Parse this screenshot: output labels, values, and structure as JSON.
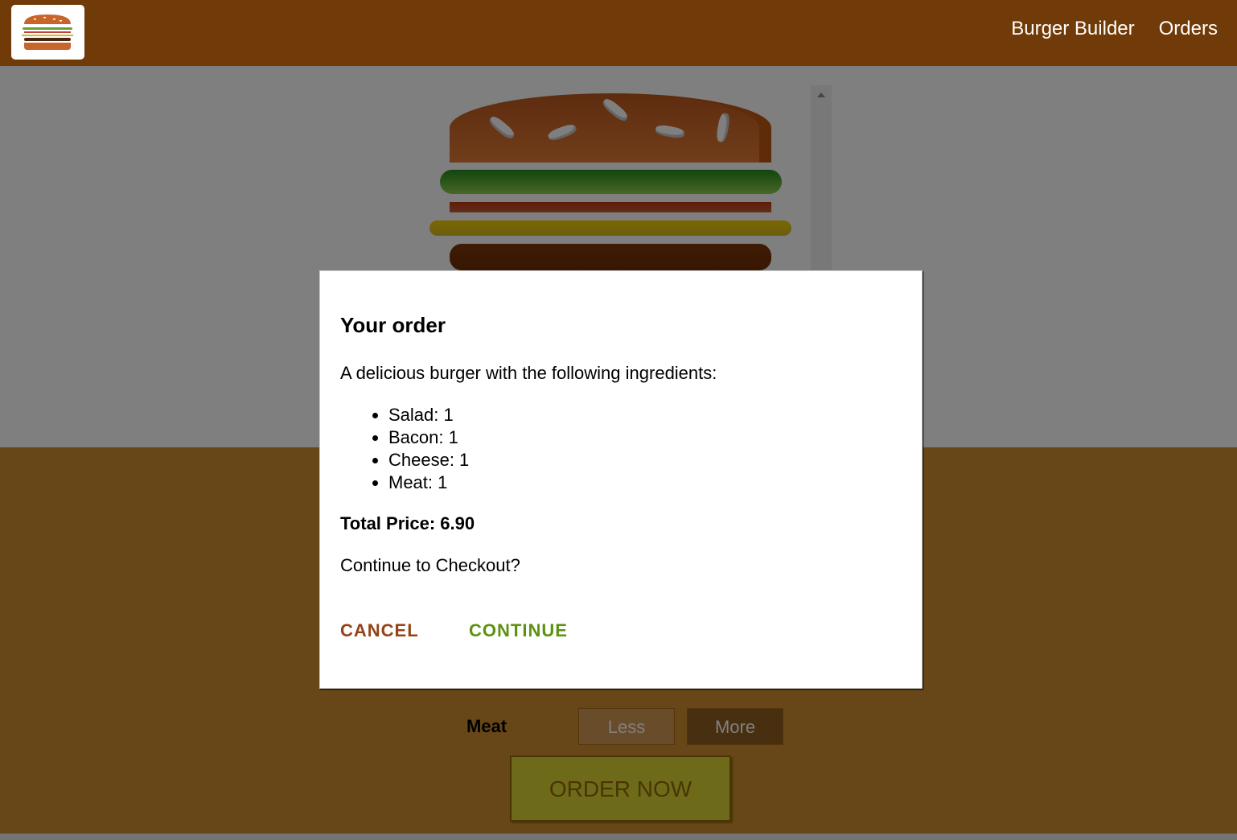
{
  "nav": {
    "logo_icon": "burger-logo-icon",
    "items": [
      {
        "label": "Burger Builder"
      },
      {
        "label": "Orders"
      }
    ]
  },
  "burger": {
    "layers": [
      "bread-top",
      "salad",
      "bacon",
      "cheese",
      "meat"
    ]
  },
  "controls": {
    "ingredient_label": "Meat",
    "less_label": "Less",
    "more_label": "More",
    "order_label": "ORDER NOW"
  },
  "modal": {
    "title": "Your order",
    "description": "A delicious burger with the following ingredients:",
    "ingredients": [
      {
        "text": "Salad: 1"
      },
      {
        "text": "Bacon: 1"
      },
      {
        "text": "Cheese: 1"
      },
      {
        "text": "Meat: 1"
      }
    ],
    "total": "Total Price: 6.90",
    "question": "Continue to Checkout?",
    "cancel_label": "CANCEL",
    "continue_label": "CONTINUE"
  },
  "colors": {
    "toolbar": "#703B09",
    "controls_bg": "#CF8F2E",
    "cancel": "#944317",
    "continue": "#5C9210"
  }
}
